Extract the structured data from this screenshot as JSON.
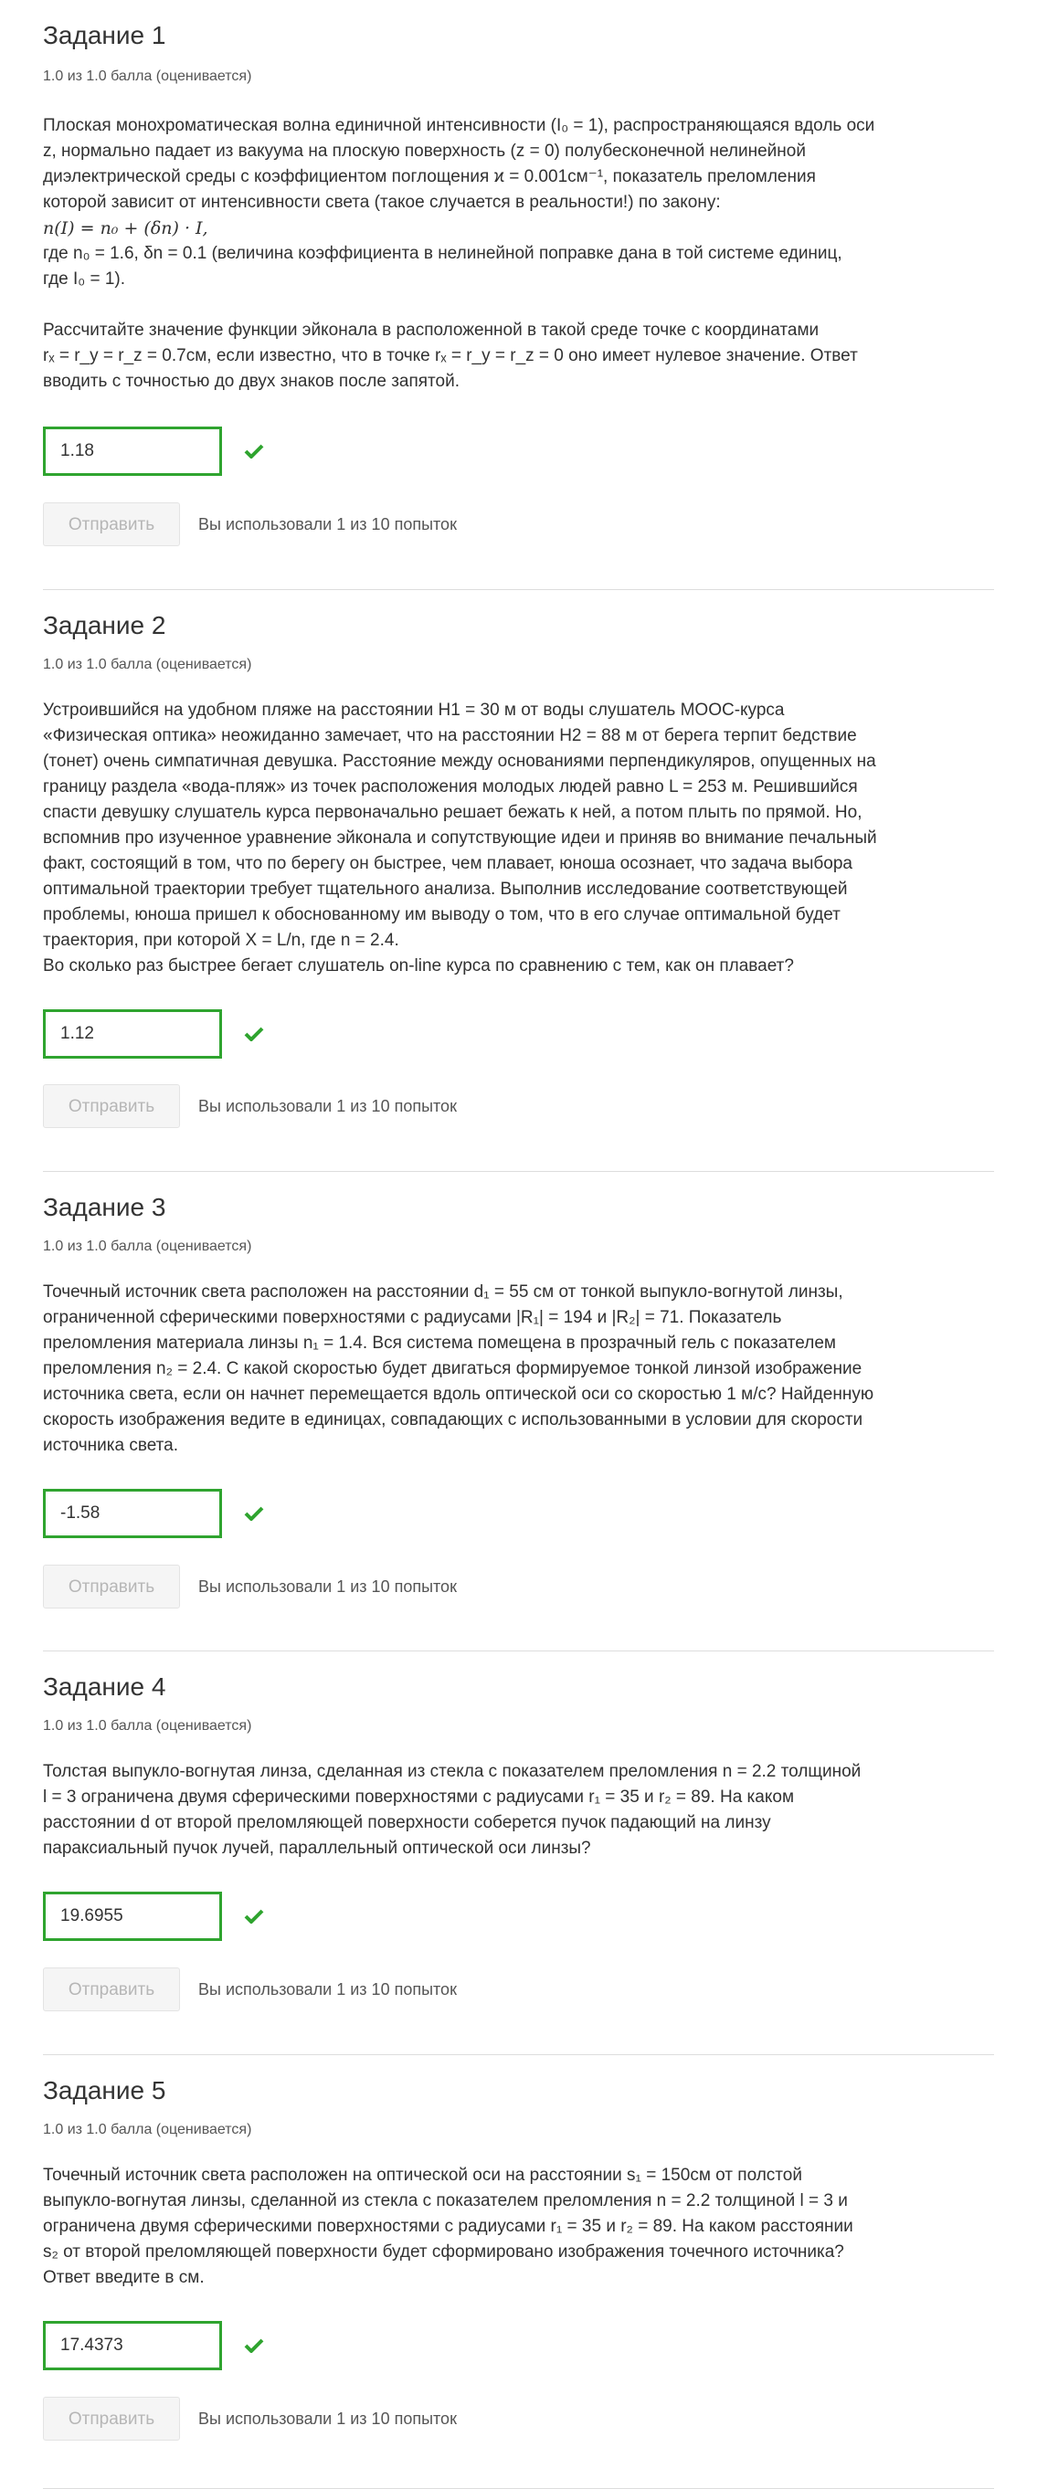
{
  "problems": [
    {
      "title": "Задание 1",
      "score": "1.0 из 1.0 балла (оценивается)",
      "lines": [
        "Плоская монохроматическая волна единичной интенсивности (I₀ = 1), распространяющаяся вдоль оси",
        "z, нормально падает из вакуума на плоскую поверхность (z = 0) полубесконечной нелинейной",
        "диэлектрической среды с коэффициентом поглощения ϰ = 0.001см⁻¹, показатель преломления",
        "которой зависит от интенсивности света (такое случается в реальности!) по закону:",
        "n(I) = n₀ + (δn) · I,",
        "где n₀ = 1.6, δn = 0.1 (величина коэффициента в нелинейной поправке дана в той системе единиц,",
        "где I₀ = 1).",
        "",
        "Рассчитайте значение функции эйконала в расположенной в такой среде точке с координатами",
        "rₓ = r_y = r_z = 0.7см, если известно, что в точке rₓ = r_y = r_z = 0 оно имеет нулевое значение. Ответ",
        "вводить с точностью до двух знаков после запятой."
      ],
      "answer": "1.18",
      "submit_label": "Отправить",
      "attempts": "Вы использовали 1 из 10 попыток"
    },
    {
      "title": "Задание 2",
      "score": "1.0 из 1.0 балла (оценивается)",
      "lines": [
        "Устроившийся на удобном пляже на расстоянии H1 = 30 м от воды слушатель МООС-курса",
        "«Физическая оптика» неожиданно замечает, что на расстоянии H2 = 88 м от берега терпит бедствие",
        "(тонет) очень симпатичная девушка. Расстояние между основаниями перпендикуляров, опущенных на",
        "границу раздела «вода-пляж» из точек расположения молодых людей равно L = 253 м. Решившийся",
        "спасти девушку слушатель курса первоначально решает бежать к ней, а потом плыть по прямой. Но,",
        "вспомнив про изученное уравнение эйконала и сопутствующие идеи и приняв во внимание печальный",
        "факт, состоящий в том, что по берегу он быстрее, чем плавает, юноша осознает, что задача выбора",
        "оптимальной траектории требует тщательного анализа. Выполнив исследование соответствующей",
        "проблемы, юноша пришел к обоснованному им выводу о том, что в его случае оптимальной будет",
        "траектория, при которой X = L/n, где n = 2.4.",
        "Во сколько раз быстрее бегает слушатель on-line курса по сравнению с тем, как он плавает?"
      ],
      "answer": "1.12",
      "submit_label": "Отправить",
      "attempts": "Вы использовали 1 из 10 попыток"
    },
    {
      "title": "Задание 3",
      "score": "1.0 из 1.0 балла (оценивается)",
      "lines": [
        "Точечный источник света расположен на расстоянии d₁ = 55 см от тонкой выпукло-вогнутой линзы,",
        "ограниченной сферическими поверхностями с радиусами |R₁| = 194 и |R₂| = 71. Показатель",
        "преломления материала линзы n₁ = 1.4. Вся система помещена в прозрачный гель с показателем",
        "преломления n₂ = 2.4. С какой скоростью будет двигаться формируемое тонкой линзой изображение",
        "источника света, если он начнет перемещается вдоль оптической оси со скоростью 1 м/с? Найденную",
        "скорость изображения ведите в единицах, совпадающих с использованными в условии для скорости",
        "источника света."
      ],
      "answer": "-1.58",
      "submit_label": "Отправить",
      "attempts": "Вы использовали 1 из 10 попыток"
    },
    {
      "title": "Задание 4",
      "score": "1.0 из 1.0 балла (оценивается)",
      "lines": [
        "Толстая выпукло-вогнутая линза, сделанная из стекла с показателем преломления n = 2.2 толщиной",
        "l = 3 ограничена двумя сферическими поверхностями с радиусами r₁ = 35 и r₂ = 89. На каком",
        "расстоянии d от второй преломляющей поверхности соберется пучок падающий на линзу",
        "параксиальный пучок лучей, параллельный оптической оси линзы?"
      ],
      "answer": "19.6955",
      "submit_label": "Отправить",
      "attempts": "Вы использовали 1 из 10 попыток"
    },
    {
      "title": "Задание 5",
      "score": "1.0 из 1.0 балла (оценивается)",
      "lines": [
        "Точечный источник света расположен на оптической оси на расстоянии s₁ = 150см от полстой",
        "выпукло-вогнутая линзы, сделанной из стекла с показателем преломления n = 2.2 толщиной l = 3 и",
        "ограничена двумя сферическими поверхностями с радиусами r₁ = 35 и r₂ = 89. На каком расстоянии",
        "s₂ от второй преломляющей поверхности будет сформировано изображения точечного источника?",
        "Ответ введите в см."
      ],
      "answer": "17.4373",
      "submit_label": "Отправить",
      "attempts": "Вы использовали 1 из 10 попыток"
    }
  ],
  "colors": {
    "correct": "#2fa42f",
    "divider": "#dddddd"
  },
  "icons": {
    "status": "check-icon"
  }
}
